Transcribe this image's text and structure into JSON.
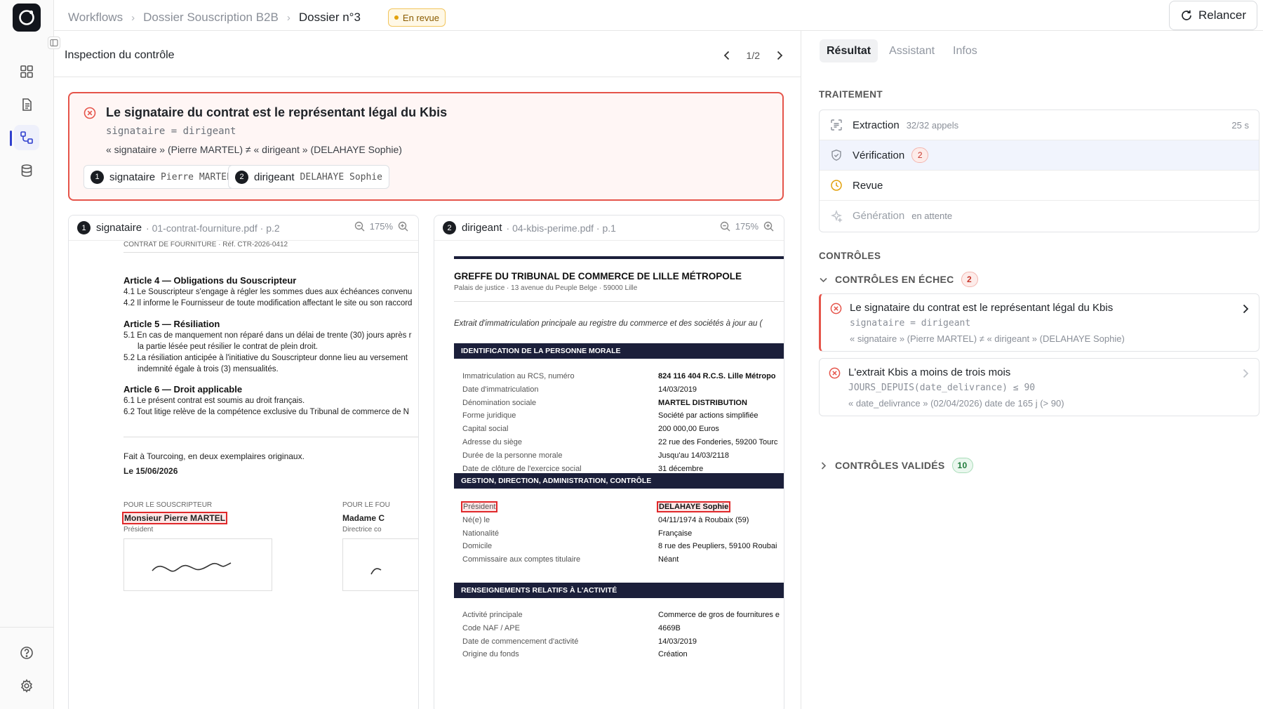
{
  "app": {
    "accent": "#2f3fce",
    "error_color": "#e5544a"
  },
  "breadcrumb": {
    "items": [
      "Workflows",
      "Dossier Souscription B2B",
      "Dossier n°3"
    ],
    "status": "En revue"
  },
  "toolbar": {
    "relancer_label": "Relancer"
  },
  "inspection": {
    "title": "Inspection du contrôle",
    "page": "1/2"
  },
  "failed_control": {
    "title": "Le signataire du contrat est le représentant légal du Kbis",
    "expression": "signataire = dirigeant",
    "detail": "« signataire » (Pierre MARTEL) ≠ « dirigeant » (DELAHAYE Sophie)",
    "chips": [
      {
        "num": "1",
        "name": "signataire",
        "value": "Pierre MARTEL"
      },
      {
        "num": "2",
        "name": "dirigeant",
        "value": "DELAHAYE Sophie"
      }
    ]
  },
  "doc1": {
    "num": "1",
    "field": "signataire",
    "file": "· 01-contrat-fourniture.pdf · p.2",
    "zoom": "175%",
    "header": "CONTRAT DE FOURNITURE  ·  Réf. CTR-2026-0412",
    "a4": "Article 4 — Obligations du Souscripteur",
    "a4_1": "4.1  Le Souscripteur s'engage à régler les sommes dues aux échéances convenu",
    "a4_2": "4.2  Il informe le Fournisseur de toute modification affectant le site ou son raccord",
    "a5": "Article 5 — Résiliation",
    "a5_1": "5.1  En cas de manquement non réparé dans un délai de trente (30) jours après r",
    "a5_1b": "la partie lésée peut résilier le contrat de plein droit.",
    "a5_2": "5.2  La résiliation anticipée à l'initiative du Souscripteur donne lieu au versement",
    "a5_2b": "indemnité égale à trois (3) mensualités.",
    "a6": "Article 6 — Droit applicable",
    "a6_1": "6.1  Le présent contrat est soumis au droit français.",
    "a6_2": "6.2  Tout litige relève de la compétence exclusive du Tribunal de commerce de N",
    "fait": "Fait à Tourcoing, en deux exemplaires originaux.",
    "date": "Le 15/06/2026",
    "sig1_for": "POUR LE SOUSCRIPTEUR",
    "sig1_name": "Monsieur Pierre MARTEL",
    "sig1_role": "Président",
    "sig2_for": "POUR LE FOU",
    "sig2_name": "Madame C",
    "sig2_role": "Directrice co"
  },
  "doc2": {
    "num": "2",
    "field": "dirigeant",
    "file": "· 04-kbis-perime.pdf · p.1",
    "zoom": "175%",
    "title": "GREFFE DU TRIBUNAL DE COMMERCE DE LILLE MÉTROPOLE",
    "address": "Palais de justice · 13 avenue du Peuple Belge · 59000 Lille",
    "extract": "Extrait d'immatriculation principale au registre du commerce et des sociétés à jour au (",
    "sec1": "IDENTIFICATION DE LA PERSONNE MORALE",
    "rows1": [
      {
        "label": "Immatriculation au RCS, numéro",
        "value": "824 116 404 R.C.S. Lille Métropo",
        "bold": true
      },
      {
        "label": "Date d'immatriculation",
        "value": "14/03/2019"
      },
      {
        "label": "Dénomination sociale",
        "value": "MARTEL DISTRIBUTION",
        "bold": true
      },
      {
        "label": "Forme juridique",
        "value": "Société par actions simplifiée"
      },
      {
        "label": "Capital social",
        "value": "200 000,00 Euros"
      },
      {
        "label": "Adresse du siège",
        "value": "22 rue des Fonderies, 59200 Tourc"
      },
      {
        "label": "Durée de la personne morale",
        "value": "Jusqu'au 14/03/2118"
      },
      {
        "label": "Date de clôture de l'exercice social",
        "value": "31 décembre"
      }
    ],
    "sec2": "GESTION, DIRECTION, ADMINISTRATION, CONTRÔLE",
    "rows2": [
      {
        "label": "Président",
        "value": "DELAHAYE Sophie",
        "highlight": true
      },
      {
        "label": "Né(e) le",
        "value": "04/11/1974 à Roubaix (59)"
      },
      {
        "label": "Nationalité",
        "value": "Française"
      },
      {
        "label": "Domicile",
        "value": "8 rue des Peupliers, 59100 Roubai"
      },
      {
        "label": "Commissaire aux comptes titulaire",
        "value": "Néant"
      }
    ],
    "sec3": "RENSEIGNEMENTS RELATIFS À L'ACTIVITÉ",
    "rows3": [
      {
        "label": "Activité principale",
        "value": "Commerce de gros de fournitures e"
      },
      {
        "label": "Code NAF / APE",
        "value": "4669B"
      },
      {
        "label": "Date de commencement d'activité",
        "value": "14/03/2019"
      },
      {
        "label": "Origine du fonds",
        "value": "Création"
      }
    ]
  },
  "right": {
    "tabs": [
      "Résultat",
      "Assistant",
      "Infos"
    ],
    "traitement_title": "TRAITEMENT",
    "steps": [
      {
        "name": "Extraction",
        "sub": "32/32 appels",
        "duration": "25 s"
      },
      {
        "name": "Vérification",
        "count": "2"
      },
      {
        "name": "Revue"
      },
      {
        "name": "Génération",
        "sub": "en attente"
      }
    ],
    "controles_title": "CONTRÔLES",
    "failed_group": {
      "label": "CONTRÔLES EN ÉCHEC",
      "count": "2"
    },
    "failed": [
      {
        "title": "Le signataire du contrat est le représentant légal du Kbis",
        "expr": "signataire = dirigeant",
        "detail": "« signataire » (Pierre MARTEL) ≠ « dirigeant » (DELAHAYE Sophie)"
      },
      {
        "title": "L'extrait Kbis a moins de trois mois",
        "expr": "JOURS_DEPUIS(date_delivrance) ≤ 90",
        "detail": "« date_delivrance » (02/04/2026) date de 165 j (> 90)"
      }
    ],
    "validated_group": {
      "label": "CONTRÔLES VALIDÉS",
      "count": "10"
    }
  }
}
